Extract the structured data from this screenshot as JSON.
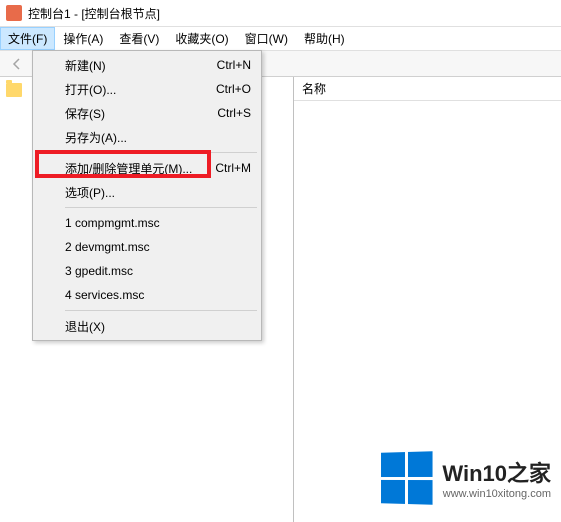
{
  "title": "控制台1 - [控制台根节点]",
  "menubar": {
    "file": "文件(F)",
    "action": "操作(A)",
    "view": "查看(V)",
    "favorites": "收藏夹(O)",
    "window": "窗口(W)",
    "help": "帮助(H)"
  },
  "right_pane": {
    "column_name": "名称"
  },
  "dropdown": {
    "new": {
      "label": "新建(N)",
      "shortcut": "Ctrl+N"
    },
    "open": {
      "label": "打开(O)...",
      "shortcut": "Ctrl+O"
    },
    "save": {
      "label": "保存(S)",
      "shortcut": "Ctrl+S"
    },
    "saveas": {
      "label": "另存为(A)..."
    },
    "snapin": {
      "label": "添加/删除管理单元(M)...",
      "shortcut": "Ctrl+M"
    },
    "options": {
      "label": "选项(P)..."
    },
    "recent1": {
      "label": "1 compmgmt.msc"
    },
    "recent2": {
      "label": "2 devmgmt.msc"
    },
    "recent3": {
      "label": "3 gpedit.msc"
    },
    "recent4": {
      "label": "4 services.msc"
    },
    "exit": {
      "label": "退出(X)"
    }
  },
  "watermark": {
    "brand": "Win10之家",
    "url": "www.win10xitong.com"
  }
}
